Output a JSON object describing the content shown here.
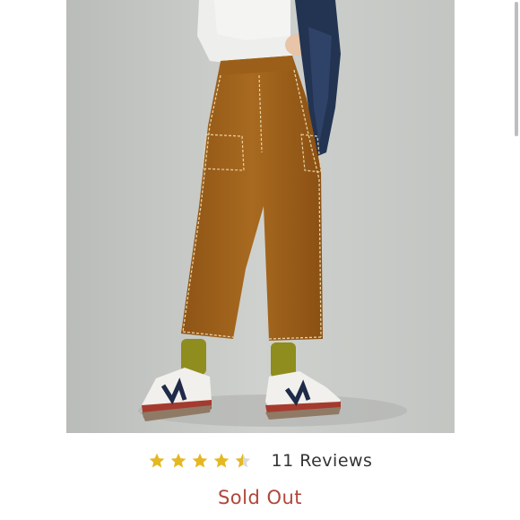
{
  "product": {
    "image_alt": "",
    "rating": 4.5,
    "rating_max": 5,
    "reviews_label": "11 Reviews",
    "status_label": "Sold Out"
  },
  "colors": {
    "star": "#e5b722",
    "star_empty": "#d9d9d9",
    "sold_out": "#b0473b",
    "text": "#333333"
  },
  "icons": {
    "star": "star-icon",
    "half_star": "half-star-icon"
  }
}
